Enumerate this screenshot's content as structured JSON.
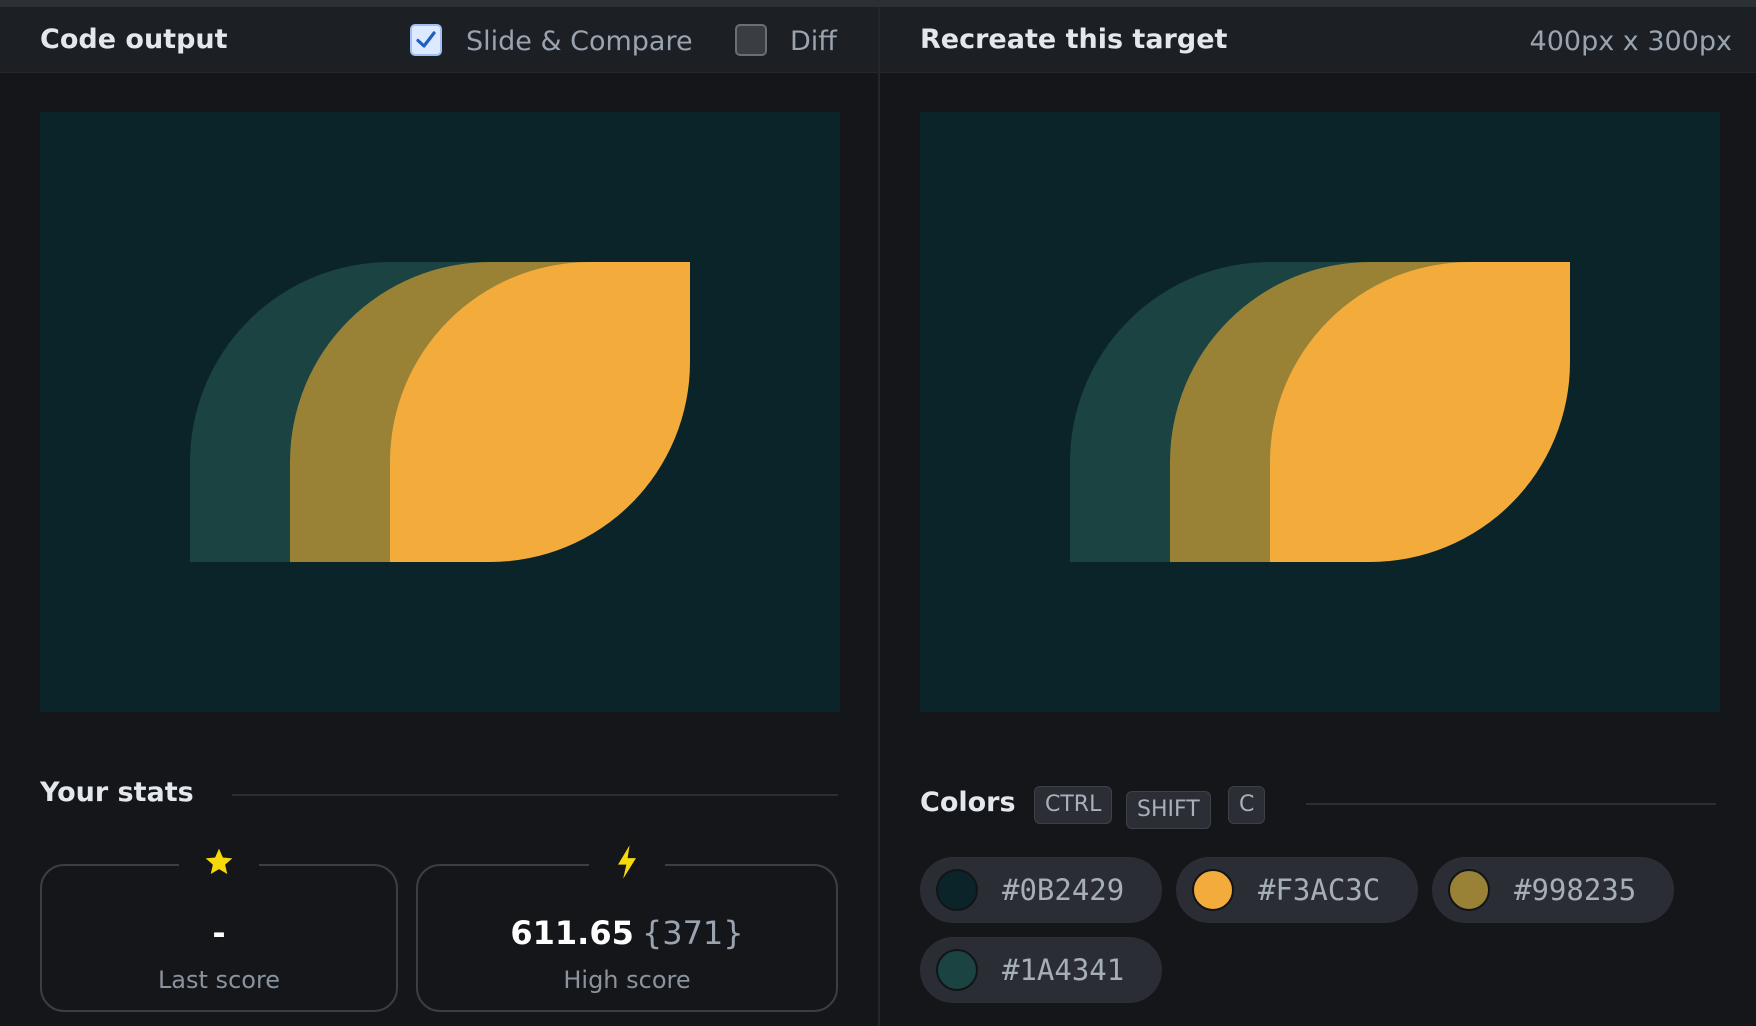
{
  "output": {
    "title": "Code output",
    "slide_compare_label": "Slide & Compare",
    "slide_compare_checked": true,
    "diff_label": "Diff",
    "diff_checked": false
  },
  "target": {
    "title": "Recreate this target",
    "dimensions": "400px x 300px"
  },
  "stats": {
    "title": "Your stats",
    "last_score_value": "-",
    "last_score_label": "Last score",
    "last_score_icon": "star-icon",
    "high_score_value": "611.65",
    "high_score_extra": "{371}",
    "high_score_label": "High score",
    "high_score_icon": "lightning-icon"
  },
  "colors": {
    "title": "Colors",
    "shortcut_keys": [
      "CTRL",
      "SHIFT",
      "C"
    ],
    "swatches": [
      {
        "hex": "#0B2429"
      },
      {
        "hex": "#F3AC3C"
      },
      {
        "hex": "#998235"
      },
      {
        "hex": "#1A4341"
      }
    ]
  },
  "theme": {
    "background": "#141619",
    "accent_check": "#dce9ff",
    "star_color": "#f5d90a",
    "bolt_color": "#f5d90a"
  }
}
